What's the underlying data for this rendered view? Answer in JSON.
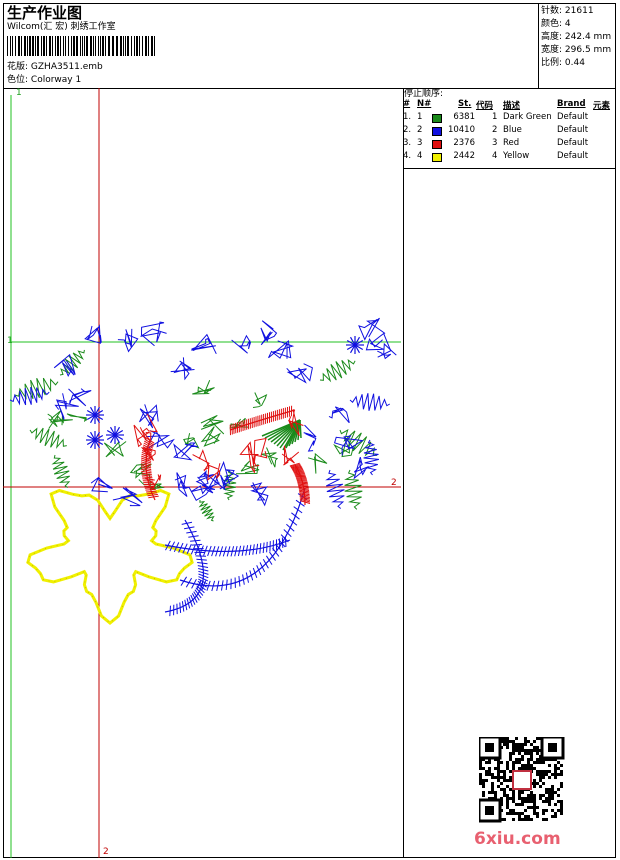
{
  "header": {
    "title": "生产作业图",
    "company": "Wilcom(汇 宏) 刺绣工作室",
    "design_label": "花版:",
    "design_value": "GZHA3511.emb",
    "colorway_label": "色位:",
    "colorway_value": "Colorway 1"
  },
  "stats": [
    {
      "label": "针数:",
      "value": "21611"
    },
    {
      "label": "颜色:",
      "value": "4"
    },
    {
      "label": "高度:",
      "value": "242.4 mm"
    },
    {
      "label": "宽度:",
      "value": "296.5 mm"
    },
    {
      "label": "比例:",
      "value": "0.44"
    }
  ],
  "stop_sequence": {
    "title": "停止顺序:",
    "columns": [
      "#",
      "N#",
      "St.",
      "代码",
      "描述",
      "Brand",
      "元素"
    ],
    "rows": [
      {
        "idx": "1.",
        "n": "1",
        "color": "#1a8a1a",
        "st": "6381",
        "code": "1",
        "desc": "Dark Green",
        "brand": "Default"
      },
      {
        "idx": "2.",
        "n": "2",
        "color": "#1010e0",
        "st": "10410",
        "code": "2",
        "desc": "Blue",
        "brand": "Default"
      },
      {
        "idx": "3.",
        "n": "3",
        "color": "#e01010",
        "st": "2376",
        "code": "3",
        "desc": "Red",
        "brand": "Default"
      },
      {
        "idx": "4.",
        "n": "4",
        "color": "#f0f000",
        "st": "2442",
        "code": "4",
        "desc": "Yellow",
        "brand": "Default"
      }
    ]
  },
  "guides": {
    "label_1": "1",
    "label_2": "2"
  },
  "watermark": "6xiu.com",
  "colors": {
    "green": "#1a8a1a",
    "blue": "#1010e0",
    "red": "#e01010",
    "yellow": "#f0f000",
    "guide_green": "#20c020",
    "guide_red": "#c00000"
  }
}
